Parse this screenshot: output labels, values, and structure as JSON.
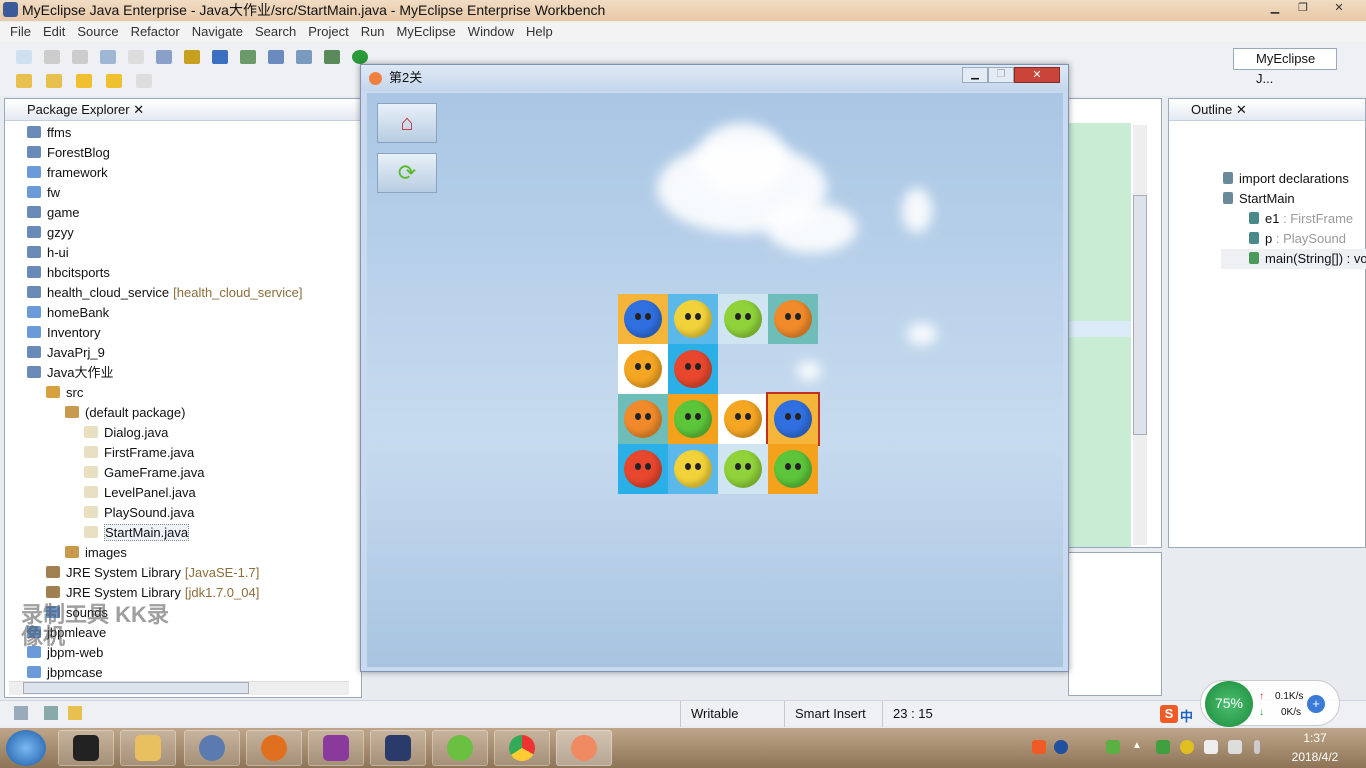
{
  "window": {
    "title": "MyEclipse Java Enterprise - Java大作业/src/StartMain.java - MyEclipse Enterprise Workbench"
  },
  "menu": [
    "File",
    "Edit",
    "Source",
    "Refactor",
    "Navigate",
    "Search",
    "Project",
    "Run",
    "MyEclipse",
    "Window",
    "Help"
  ],
  "perspective": "MyEclipse J...",
  "package_explorer": {
    "title": "Package Explorer",
    "items": [
      {
        "label": "ffms",
        "level": 0,
        "type": "project"
      },
      {
        "label": "ForestBlog",
        "level": 0,
        "type": "project"
      },
      {
        "label": "framework",
        "level": 0,
        "type": "folder"
      },
      {
        "label": "fw",
        "level": 0,
        "type": "folder"
      },
      {
        "label": "game",
        "level": 0,
        "type": "project"
      },
      {
        "label": "gzyy",
        "level": 0,
        "type": "project"
      },
      {
        "label": "h-ui",
        "level": 0,
        "type": "project"
      },
      {
        "label": "hbcitsports",
        "level": 0,
        "type": "project"
      },
      {
        "label": "health_cloud_service",
        "decoration": "[health_cloud_service]",
        "level": 0,
        "type": "project"
      },
      {
        "label": "homeBank",
        "level": 0,
        "type": "folder"
      },
      {
        "label": "Inventory",
        "level": 0,
        "type": "folder"
      },
      {
        "label": "JavaPrj_9",
        "level": 0,
        "type": "project"
      },
      {
        "label": "Java大作业",
        "level": 0,
        "type": "project"
      },
      {
        "label": "src",
        "level": 1,
        "type": "srcfolder"
      },
      {
        "label": "(default package)",
        "level": 2,
        "type": "package"
      },
      {
        "label": "Dialog.java",
        "level": 3,
        "type": "java"
      },
      {
        "label": "FirstFrame.java",
        "level": 3,
        "type": "java"
      },
      {
        "label": "GameFrame.java",
        "level": 3,
        "type": "java"
      },
      {
        "label": "LevelPanel.java",
        "level": 3,
        "type": "java"
      },
      {
        "label": "PlaySound.java",
        "level": 3,
        "type": "java"
      },
      {
        "label": "StartMain.java",
        "level": 3,
        "type": "java",
        "selected": true
      },
      {
        "label": "images",
        "level": 2,
        "type": "package"
      },
      {
        "label": "JRE System Library",
        "decoration": "[JavaSE-1.7]",
        "level": 1,
        "type": "library"
      },
      {
        "label": "JRE System Library",
        "decoration": "[jdk1.7.0_04]",
        "level": 1,
        "type": "library"
      },
      {
        "label": "sounds",
        "level": 1,
        "type": "folder"
      },
      {
        "label": "jbpmleave",
        "level": 0,
        "type": "folder"
      },
      {
        "label": "jbpm-web",
        "level": 0,
        "type": "folder"
      },
      {
        "label": "jbpmcase",
        "level": 0,
        "type": "folder"
      }
    ]
  },
  "game_window": {
    "title": "第2关",
    "home_icon": "home-icon",
    "refresh_icon": "refresh-icon",
    "board": [
      [
        "blueberry",
        "pineapple",
        "green-apple",
        "orange"
      ],
      [
        "mango",
        "red-apple",
        null,
        null
      ],
      [
        "orange",
        "green-apple-orange",
        "mango",
        "blueberry"
      ],
      [
        "red-apple",
        "pineapple",
        "green-apple",
        "green-apple-orange"
      ]
    ],
    "selected": [
      2,
      3
    ]
  },
  "fruit_colors": {
    "blueberry": "#2f6fe0",
    "pineapple": "#f2d23a",
    "green-apple": "#8fd23a",
    "orange": "#f08a2a",
    "mango": "#f5a623",
    "red-apple": "#e8472e",
    "green-apple-orange": "#5cc53a"
  },
  "tile_bgs": {
    "blueberry": "#f5b53a",
    "pineapple": "#5bb8ea",
    "green-apple": "#cfe6f2",
    "orange": "#6fbdb8",
    "mango": "#ffffff",
    "red-apple": "#2ab0e6",
    "green-apple-orange": "#f4a21c"
  },
  "outline": {
    "title": "Outline",
    "items": [
      {
        "label": "import declarations",
        "type": ""
      },
      {
        "label": "StartMain",
        "type": ""
      },
      {
        "label": "e1",
        "type": " : FirstFrame"
      },
      {
        "label": "p",
        "type": " : PlaySound"
      },
      {
        "label": "main(String[]) : void",
        "type": ""
      }
    ]
  },
  "status": {
    "writable": "Writable",
    "insert_mode": "Smart Insert",
    "position": "23 : 15"
  },
  "net_widget": {
    "percent": "75%",
    "up": "0.1K/s",
    "down": "0K/s"
  },
  "watermark": "录制工具 KK录像机",
  "taskbar": {
    "time": "1:37",
    "date": "2018/4/2",
    "ime": "中"
  }
}
